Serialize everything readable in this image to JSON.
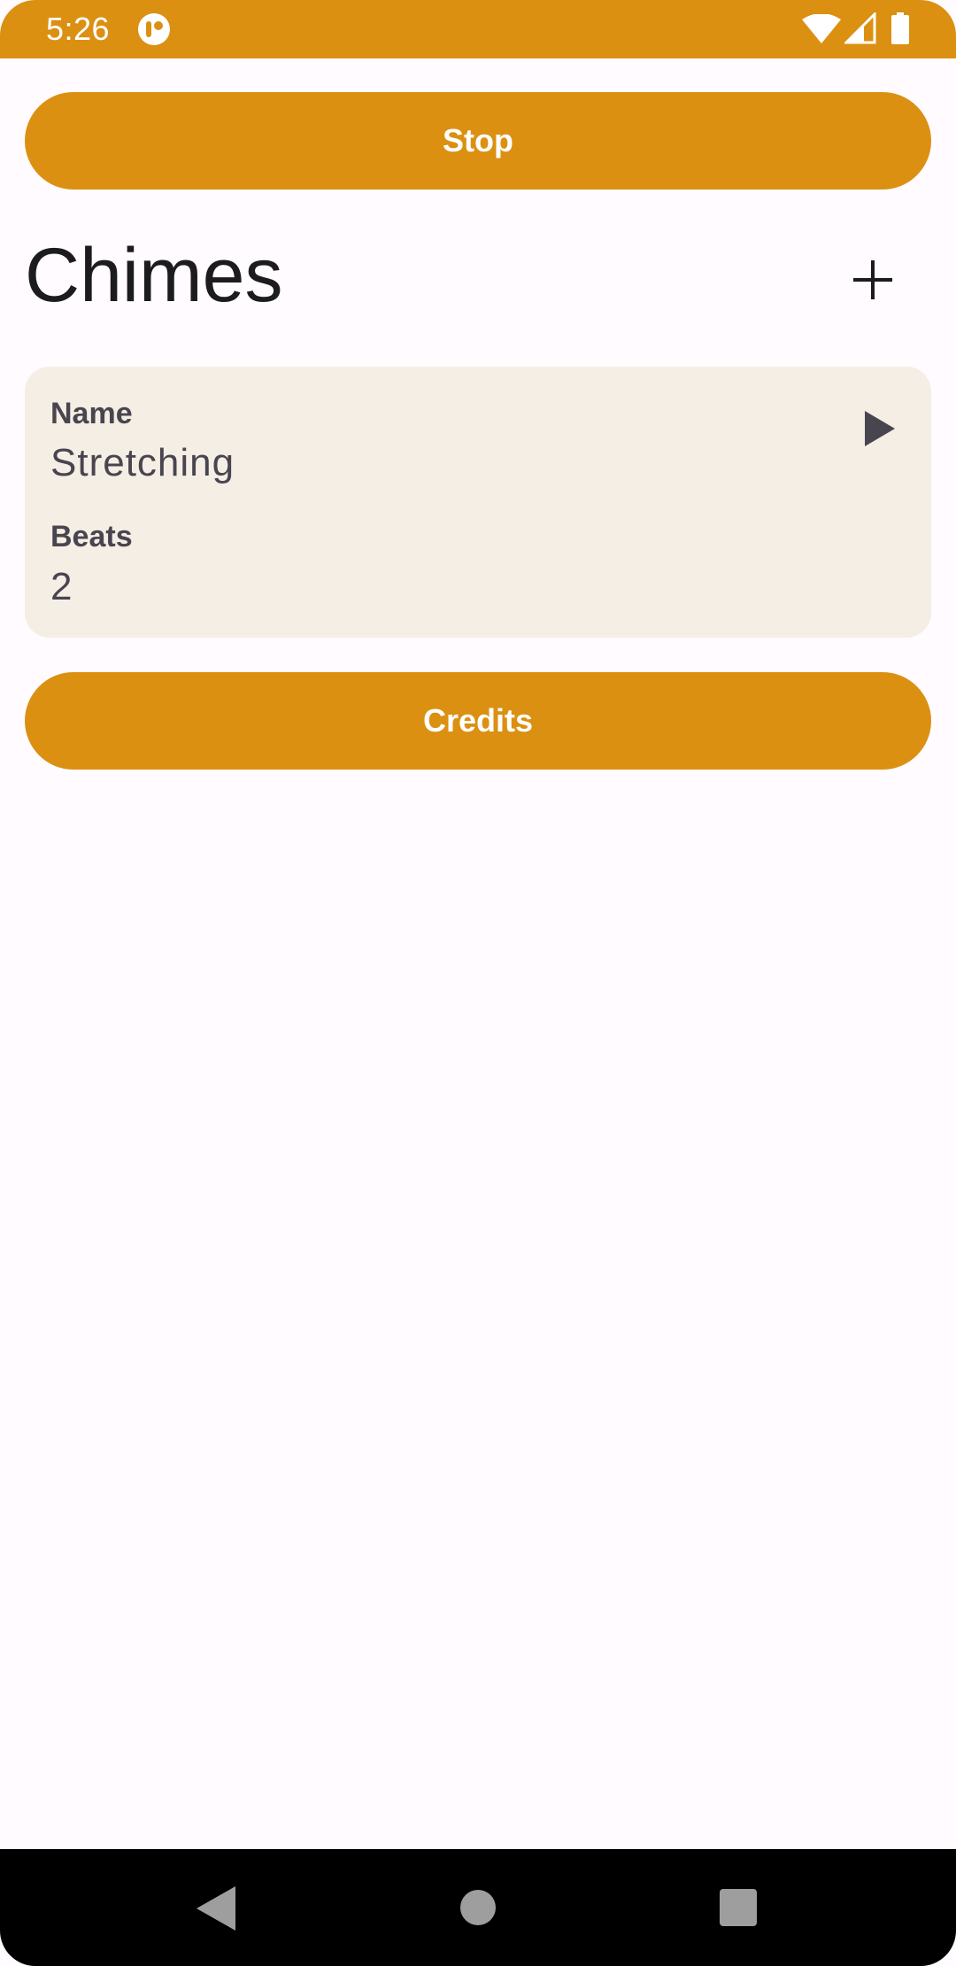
{
  "status_bar": {
    "time": "5:26",
    "background_color": "#DB9012",
    "icons": [
      "app-notification-icon",
      "wifi-icon",
      "cell-signal-icon",
      "battery-icon"
    ]
  },
  "actions": {
    "stop_label": "Stop",
    "credits_label": "Credits",
    "accent_color": "#DB9012"
  },
  "header": {
    "title": "Chimes",
    "add_icon": "plus-icon"
  },
  "chimes": [
    {
      "name_label": "Name",
      "name": "Stretching",
      "beats_label": "Beats",
      "beats": "2",
      "play_icon": "play-icon"
    }
  ],
  "nav_bar": {
    "icons": [
      "back-icon",
      "home-icon",
      "recents-icon"
    ]
  }
}
